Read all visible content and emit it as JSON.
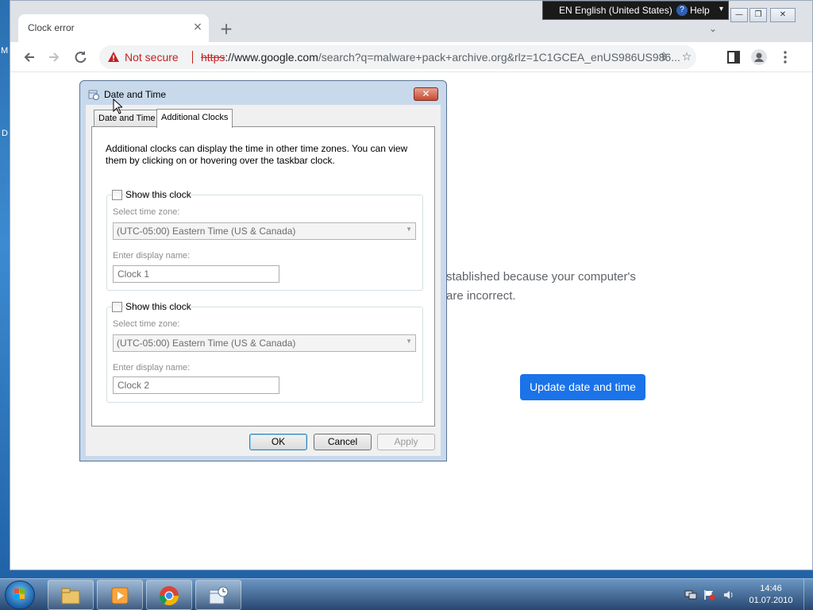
{
  "desktop": {
    "label_m": "M",
    "label_d": "D"
  },
  "browser": {
    "tab_title": "Clock error",
    "tab_close": "×",
    "new_tab": "+",
    "tab_search_arrow": "⌄",
    "security_label": "Not secure",
    "url_scheme": "https",
    "url_host": "://www.google.com",
    "url_rest": "/search?q=malware+pack+archive.org&rlz=1C1GCEA_enUS986US986...",
    "page": {
      "error_line1": "stablished because your computer's",
      "error_line2": "are incorrect.",
      "update_button": "Update date and time"
    }
  },
  "language_bar": {
    "language": "EN English (United States)",
    "help_icon_glyph": "?",
    "help_label": "Help",
    "menu_arrow": "▾"
  },
  "dialog": {
    "title": "Date and Time",
    "close_glyph": "✕",
    "tabs": [
      {
        "label": "Date and Time"
      },
      {
        "label": "Additional Clocks"
      }
    ],
    "description": "Additional clocks can display the time in other time zones. You can view them by clicking on or hovering over the taskbar clock.",
    "clocks": [
      {
        "show_label": "Show this clock",
        "checked": false,
        "timezone_label": "Select time zone:",
        "timezone_value": "(UTC-05:00) Eastern Time (US & Canada)",
        "display_name_label": "Enter display name:",
        "display_name_value": "Clock 1"
      },
      {
        "show_label": "Show this clock",
        "checked": false,
        "timezone_label": "Select time zone:",
        "timezone_value": "(UTC-05:00) Eastern Time (US & Canada)",
        "display_name_label": "Enter display name:",
        "display_name_value": "Clock 2"
      }
    ],
    "buttons": {
      "ok": "OK",
      "cancel": "Cancel",
      "apply": "Apply"
    }
  },
  "taskbar": {
    "time": "14:46",
    "date": "01.07.2010",
    "apps": [
      "file-explorer-icon",
      "media-player-icon",
      "chrome-icon",
      "date-time-control-panel-icon"
    ]
  },
  "colors": {
    "accent_blue": "#1a73e8",
    "not_secure_red": "#c5221f",
    "dialog_frame": "#c9d9ec"
  }
}
